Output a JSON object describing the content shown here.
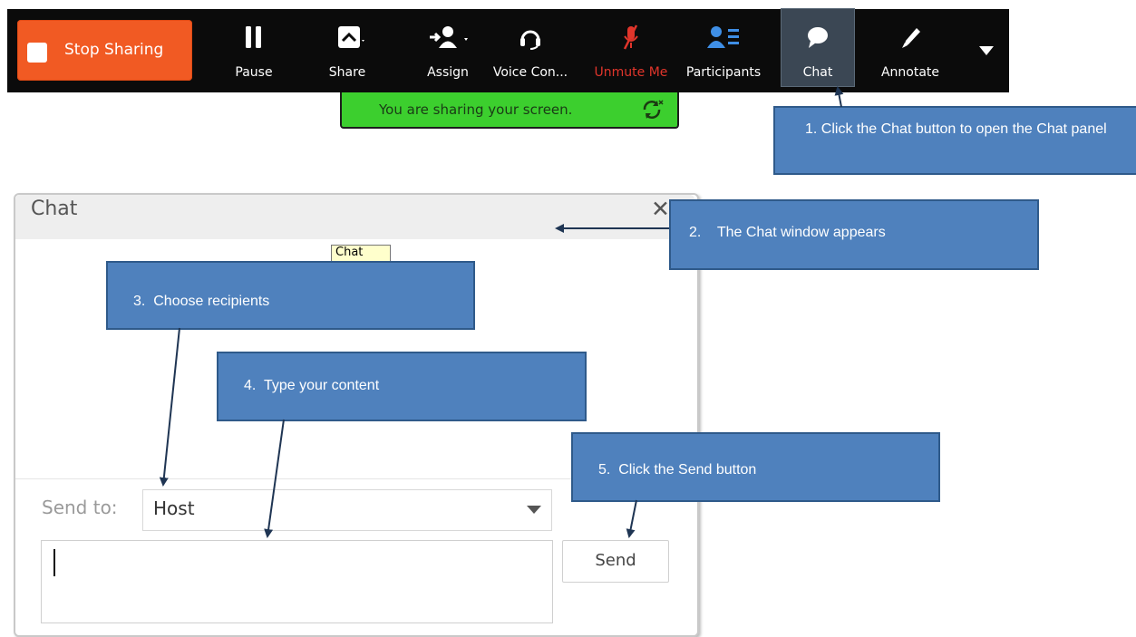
{
  "toolbar": {
    "stop_label": "Stop Sharing",
    "items": [
      {
        "label": "Pause"
      },
      {
        "label": "Share"
      },
      {
        "label": "Assign"
      },
      {
        "label": "Voice Con..."
      },
      {
        "label": "Unmute Me"
      },
      {
        "label": "Participants"
      },
      {
        "label": "Chat"
      },
      {
        "label": "Annotate"
      }
    ],
    "more_icon": "caret-down-icon"
  },
  "banner": {
    "text": "You are sharing your screen.",
    "icon": "sync-icon",
    "color": "#3ccf2e"
  },
  "chat": {
    "title": "Chat",
    "close_icon": "close-icon",
    "tooltip": "Chat",
    "send_to_label": "Send to:",
    "recipient": "Host",
    "message": "",
    "send_label": "Send"
  },
  "callouts": {
    "c1": "1.  Click  the  Chat  button  to  open  the Chat panel",
    "c2": "2.    The Chat window appears",
    "c3": "3.  Choose recipients",
    "c4": "4.  Type your content",
    "c5": "5.  Click the Send button"
  },
  "colors": {
    "accent": "#f15a23",
    "callout": "#4f81bd",
    "toolbar": "#0b0b0b",
    "warning": "#e0352b"
  }
}
